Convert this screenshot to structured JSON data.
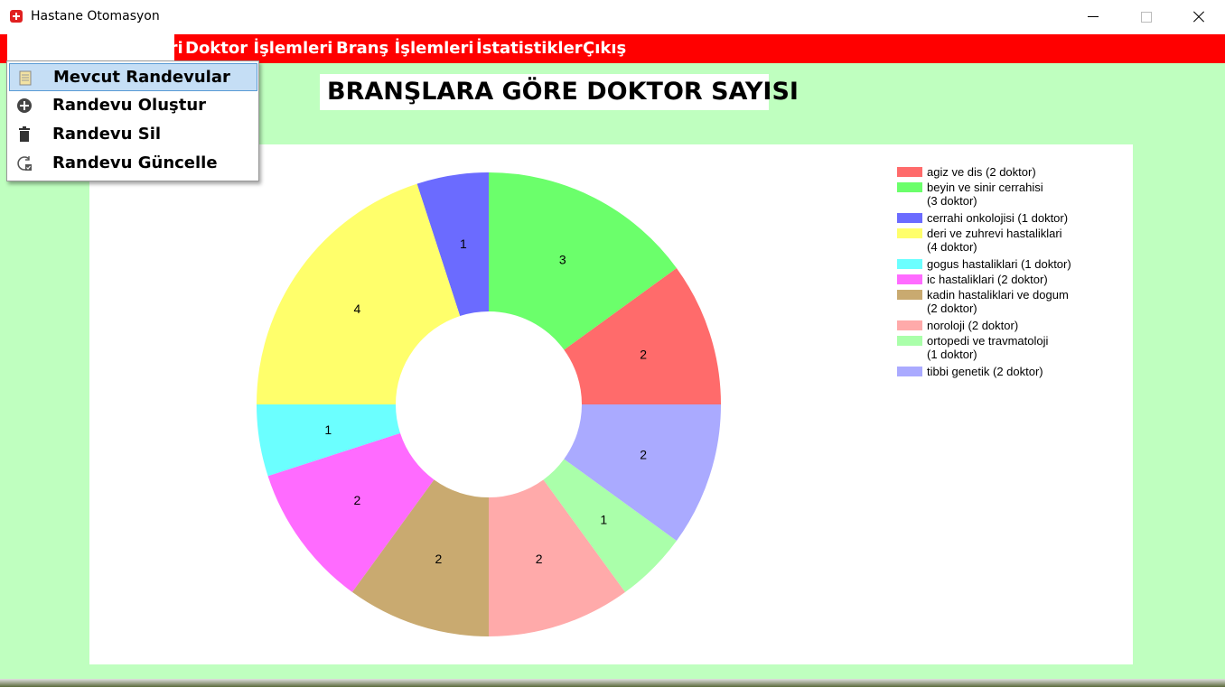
{
  "window": {
    "title": "Hastane Otomasyon"
  },
  "menubar": {
    "items": [
      {
        "label": "Randevu İşlemleri"
      },
      {
        "label": "Doktor İşlemleri"
      },
      {
        "label": "Branş İşlemleri"
      },
      {
        "label": "İstatistikler"
      },
      {
        "label": "Çıkış"
      }
    ]
  },
  "dropdown": {
    "items": [
      {
        "label": "Mevcut Randevular",
        "icon": "notepad-icon"
      },
      {
        "label": "Randevu Oluştur",
        "icon": "plus-circle-icon"
      },
      {
        "label": "Randevu Sil",
        "icon": "trash-icon"
      },
      {
        "label": "Randevu Güncelle",
        "icon": "refresh-check-icon"
      }
    ]
  },
  "heading": "BRANŞLARA GÖRE DOKTOR SAYISI",
  "chart_data": {
    "type": "pie",
    "donut": true,
    "legend_position": "top-right",
    "categories": [
      "agiz ve dis",
      "beyin ve sinir cerrahisi",
      "cerrahi onkolojisi",
      "deri ve zuhrevi hastaliklari",
      "gogus hastaliklari",
      "ic hastaliklari",
      "kadin hastaliklari ve dogum",
      "noroloji",
      "ortopedi ve travmatoloji",
      "tibbi genetik"
    ],
    "values": [
      2,
      3,
      1,
      4,
      1,
      2,
      2,
      2,
      1,
      2
    ],
    "legend_lines": [
      [
        "agiz ve dis  (2 doktor)"
      ],
      [
        "beyin ve sinir cerrahisi",
        "(3 doktor)"
      ],
      [
        "cerrahi onkolojisi  (1 doktor)"
      ],
      [
        "deri ve zuhrevi hastaliklari",
        "(4 doktor)"
      ],
      [
        "gogus hastaliklari  (1 doktor)"
      ],
      [
        "ic hastaliklari  (2 doktor)"
      ],
      [
        "kadin hastaliklari ve dogum",
        "(2 doktor)"
      ],
      [
        "noroloji  (2 doktor)"
      ],
      [
        "ortopedi ve travmatoloji",
        "(1 doktor)"
      ],
      [
        "tibbi genetik  (2 doktor)"
      ]
    ],
    "colors": [
      "#ff6b6b",
      "#6bff6b",
      "#6b6bff",
      "#ffff6b",
      "#6bffff",
      "#ff6bff",
      "#c9aa70",
      "#ffaaaa",
      "#aaffaa",
      "#aaaaff"
    ]
  }
}
